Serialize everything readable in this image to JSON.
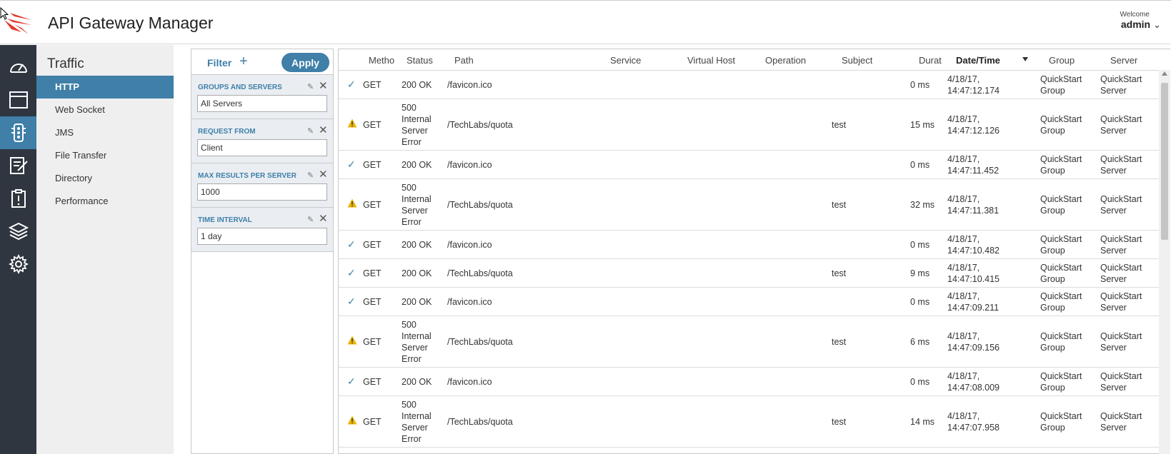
{
  "header": {
    "title": "API Gateway Manager",
    "welcome": "Welcome",
    "user": "admin"
  },
  "rail": {
    "items": [
      "dashboard-icon",
      "window-icon",
      "traffic-light-icon",
      "edit-document-icon",
      "clipboard-alert-icon",
      "layers-icon",
      "settings-gear-icon"
    ],
    "active": 2
  },
  "subnav": {
    "title": "Traffic",
    "items": [
      "HTTP",
      "Web Socket",
      "JMS",
      "File Transfer",
      "Directory",
      "Performance"
    ]
  },
  "filter": {
    "title": "Filter",
    "apply": "Apply",
    "sections": [
      {
        "label": "GROUPS AND SERVERS",
        "value": "All Servers"
      },
      {
        "label": "REQUEST FROM",
        "value": "Client"
      },
      {
        "label": "MAX RESULTS PER SERVER",
        "value": "1000"
      },
      {
        "label": "TIME INTERVAL",
        "value": "1 day"
      }
    ]
  },
  "table": {
    "columns": [
      "Metho",
      "Status",
      "Path",
      "Service",
      "Virtual Host",
      "Operation",
      "Subject",
      "Durat",
      "Date/Time",
      "Group",
      "Server"
    ],
    "rows": [
      {
        "icon": "check",
        "method": "GET",
        "status": "200 OK",
        "path": "/favicon.ico",
        "subject": "",
        "duration": "0 ms",
        "date": "4/18/17, 14:47:12.174",
        "group": "QuickStart Group",
        "server": "QuickStart Server"
      },
      {
        "icon": "warning",
        "method": "GET",
        "status": "500 Internal Server Error",
        "path": "/TechLabs/quota",
        "subject": "test",
        "duration": "15 ms",
        "date": "4/18/17, 14:47:12.126",
        "group": "QuickStart Group",
        "server": "QuickStart Server"
      },
      {
        "icon": "check",
        "method": "GET",
        "status": "200 OK",
        "path": "/favicon.ico",
        "subject": "",
        "duration": "0 ms",
        "date": "4/18/17, 14:47:11.452",
        "group": "QuickStart Group",
        "server": "QuickStart Server"
      },
      {
        "icon": "warning",
        "method": "GET",
        "status": "500 Internal Server Error",
        "path": "/TechLabs/quota",
        "subject": "test",
        "duration": "32 ms",
        "date": "4/18/17, 14:47:11.381",
        "group": "QuickStart Group",
        "server": "QuickStart Server"
      },
      {
        "icon": "check",
        "method": "GET",
        "status": "200 OK",
        "path": "/favicon.ico",
        "subject": "",
        "duration": "0 ms",
        "date": "4/18/17, 14:47:10.482",
        "group": "QuickStart Group",
        "server": "QuickStart Server"
      },
      {
        "icon": "check",
        "method": "GET",
        "status": "200 OK",
        "path": "/TechLabs/quota",
        "subject": "test",
        "duration": "9 ms",
        "date": "4/18/17, 14:47:10.415",
        "group": "QuickStart Group",
        "server": "QuickStart Server"
      },
      {
        "icon": "check",
        "method": "GET",
        "status": "200 OK",
        "path": "/favicon.ico",
        "subject": "",
        "duration": "0 ms",
        "date": "4/18/17, 14:47:09.211",
        "group": "QuickStart Group",
        "server": "QuickStart Server"
      },
      {
        "icon": "warning",
        "method": "GET",
        "status": "500 Internal Server Error",
        "path": "/TechLabs/quota",
        "subject": "test",
        "duration": "6 ms",
        "date": "4/18/17, 14:47:09.156",
        "group": "QuickStart Group",
        "server": "QuickStart Server"
      },
      {
        "icon": "check",
        "method": "GET",
        "status": "200 OK",
        "path": "/favicon.ico",
        "subject": "",
        "duration": "0 ms",
        "date": "4/18/17, 14:47:08.009",
        "group": "QuickStart Group",
        "server": "QuickStart Server"
      },
      {
        "icon": "warning",
        "method": "GET",
        "status": "500 Internal Server Error",
        "path": "/TechLabs/quota",
        "subject": "test",
        "duration": "14 ms",
        "date": "4/18/17, 14:47:07.958",
        "group": "QuickStart Group",
        "server": "QuickStart Server"
      }
    ]
  },
  "colors": {
    "accent": "#3f7fa8",
    "rail": "#2f3640",
    "warning": "#e8b400",
    "logo": "#e23a2e"
  }
}
